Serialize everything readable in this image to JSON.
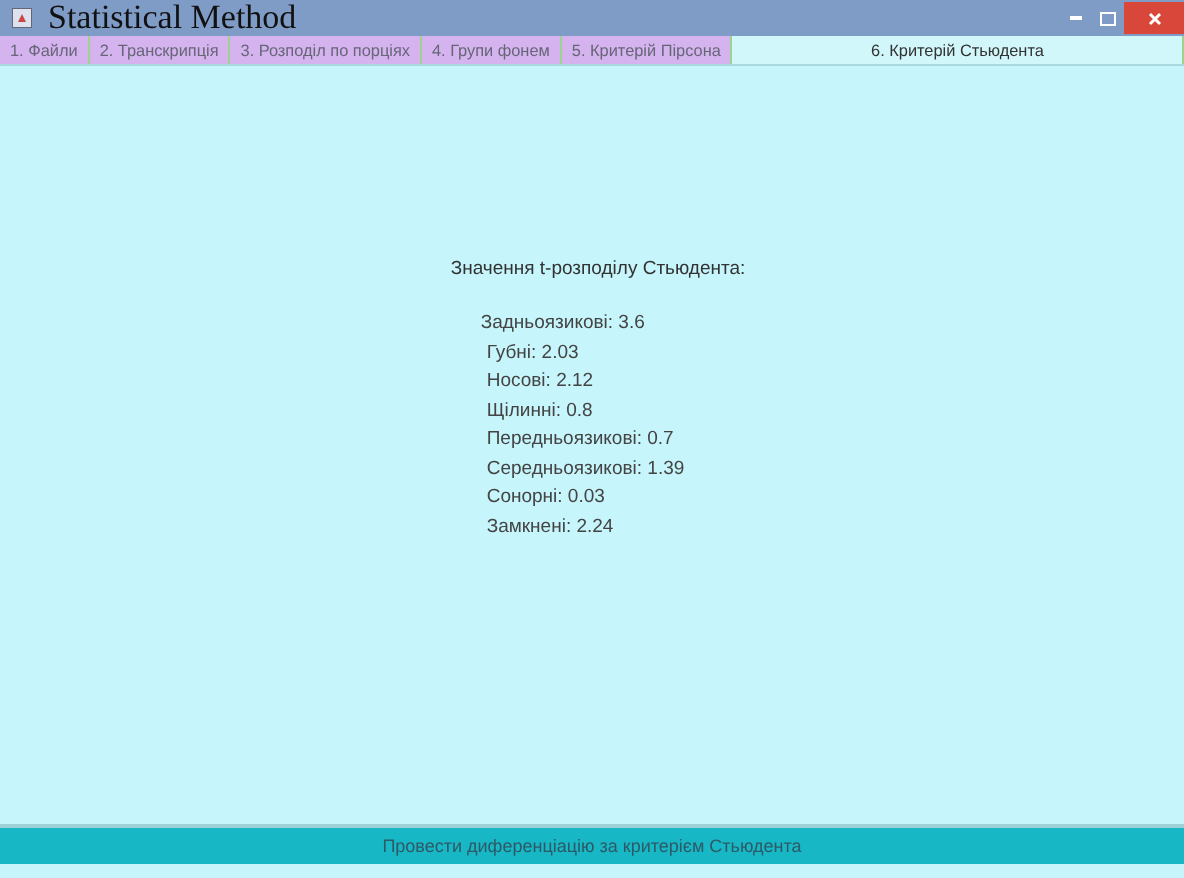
{
  "window": {
    "title": "Statistical Method"
  },
  "tabs": [
    {
      "label": "1. Файли",
      "selected": false
    },
    {
      "label": "2. Транскрипція",
      "selected": false
    },
    {
      "label": "3. Розподіл по порціях",
      "selected": false
    },
    {
      "label": "4. Групи фонем",
      "selected": false
    },
    {
      "label": "5. Критерій Пірсона",
      "selected": false
    },
    {
      "label": "6. Критерій Стьюдента",
      "selected": true
    }
  ],
  "results": {
    "heading": "Значення t-розподілу Стьюдента:",
    "lines": [
      "Задньоязикові: 3.6",
      "Губні: 2.03",
      "Носові: 2.12",
      "Щілинні: 0.8",
      "Передньоязикові: 0.7",
      "Середньоязикові: 1.39",
      "Сонорні: 0.03",
      "Замкнені: 2.24"
    ]
  },
  "action_button": "Провести диференціацію за критерієм Стьюдента"
}
